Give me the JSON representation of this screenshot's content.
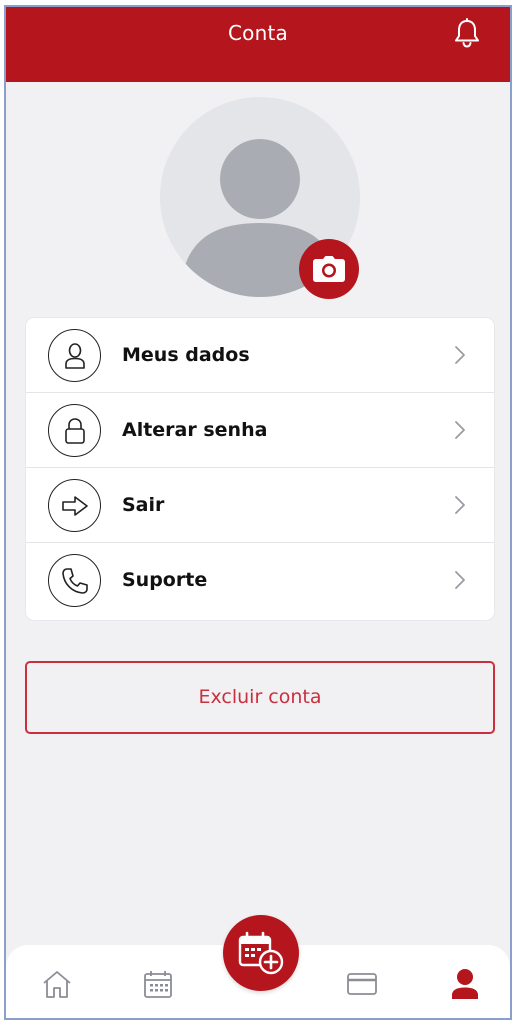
{
  "header": {
    "title": "Conta"
  },
  "menu": {
    "items": [
      {
        "label": "Meus dados",
        "icon": "user-icon"
      },
      {
        "label": "Alterar senha",
        "icon": "lock-icon"
      },
      {
        "label": "Sair",
        "icon": "arrow-right-icon"
      },
      {
        "label": "Suporte",
        "icon": "phone-icon"
      }
    ]
  },
  "account": {
    "delete_label": "Excluir conta"
  },
  "bottom_nav": {
    "items": [
      {
        "icon": "home-icon"
      },
      {
        "icon": "calendar-icon"
      },
      {
        "icon": "calendar-add-icon"
      },
      {
        "icon": "card-icon"
      },
      {
        "icon": "profile-icon",
        "active": true
      }
    ]
  },
  "colors": {
    "brand": "#b5161d",
    "danger": "#c9303f",
    "background": "#f1f1f4",
    "inactive_icon": "#8a8d94"
  }
}
